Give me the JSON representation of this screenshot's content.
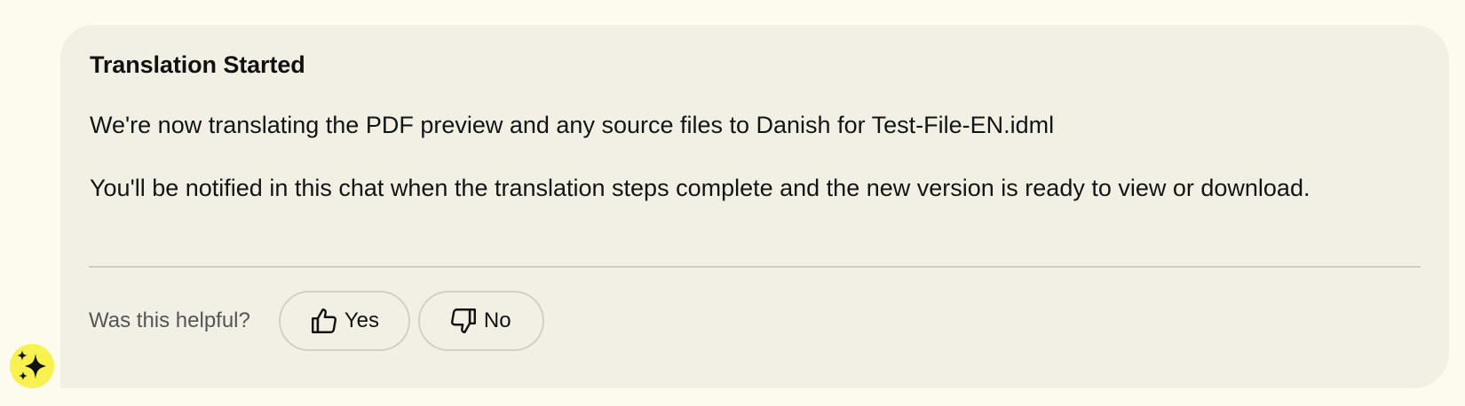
{
  "message": {
    "title": "Translation Started",
    "paragraphs": [
      "We're now translating the PDF preview and any source files to Danish for Test-File-EN.idml",
      "You'll be notified in this chat when the translation steps complete and the new version is ready to view or download."
    ]
  },
  "feedback": {
    "question": "Was this helpful?",
    "yes_label": "Yes",
    "no_label": "No",
    "yes_icon": "thumbs-up-icon",
    "no_icon": "thumbs-down-icon"
  },
  "assistant": {
    "avatar_icon": "sparkles-icon",
    "avatar_color": "#f7f24f"
  },
  "colors": {
    "page_background": "#fdfaee",
    "card_background": "#f2f0e5"
  }
}
